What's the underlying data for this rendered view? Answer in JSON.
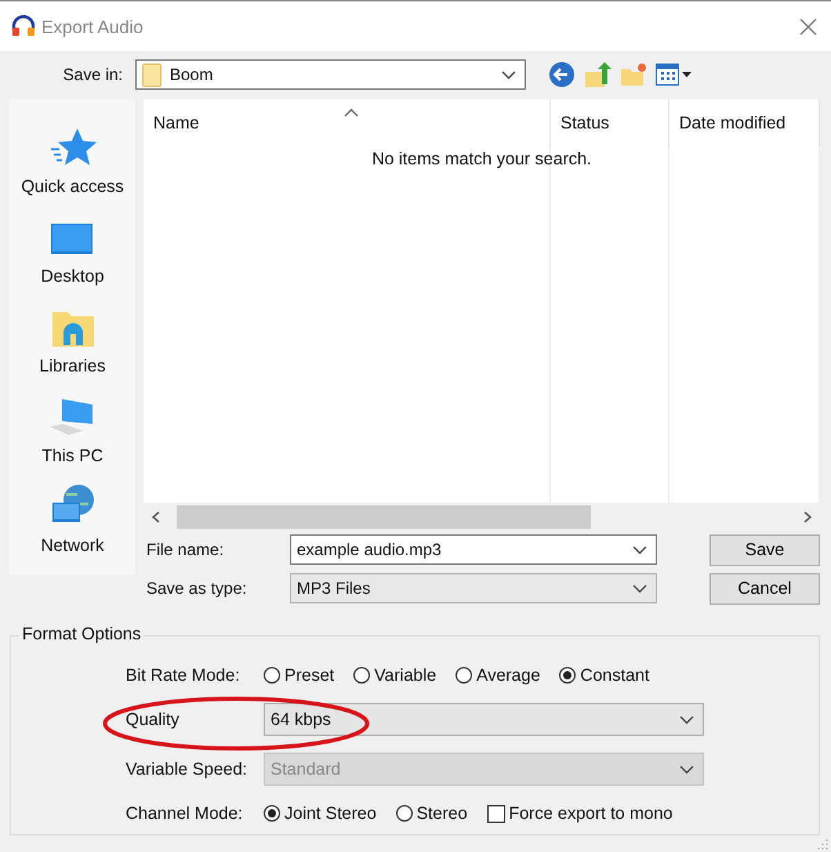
{
  "window": {
    "title": "Export Audio"
  },
  "save_in": {
    "label": "Save in:",
    "value": "Boom"
  },
  "sidebar": {
    "items": [
      {
        "label": "Quick access",
        "kind": "star"
      },
      {
        "label": "Desktop",
        "kind": "desktop"
      },
      {
        "label": "Libraries",
        "kind": "libraries"
      },
      {
        "label": "This PC",
        "kind": "computer"
      },
      {
        "label": "Network",
        "kind": "network"
      }
    ]
  },
  "file_list": {
    "columns": [
      "Name",
      "Status",
      "Date modified"
    ],
    "empty_message": "No items match your search."
  },
  "file_name": {
    "label": "File name:",
    "value": "example audio.mp3"
  },
  "save_as_type": {
    "label": "Save as type:",
    "value": "MP3 Files"
  },
  "buttons": [
    "Save",
    "Cancel"
  ],
  "format_options": {
    "title": "Format Options",
    "bit_rate_mode": {
      "label": "Bit Rate Mode:",
      "options": [
        {
          "label": "Preset",
          "selected": false
        },
        {
          "label": "Variable",
          "selected": false
        },
        {
          "label": "Average",
          "selected": false
        },
        {
          "label": "Constant",
          "selected": true
        }
      ]
    },
    "quality": {
      "label": "Quality",
      "value": "64 kbps",
      "highlighted": true
    },
    "variable_speed": {
      "label": "Variable Speed:",
      "value": "Standard",
      "disabled": true
    },
    "channel_mode": {
      "label": "Channel Mode:",
      "options": [
        {
          "label": "Joint Stereo",
          "selected": true
        },
        {
          "label": "Stereo",
          "selected": false
        }
      ]
    },
    "force_mono": {
      "label": "Force export to mono",
      "checked": false
    }
  }
}
